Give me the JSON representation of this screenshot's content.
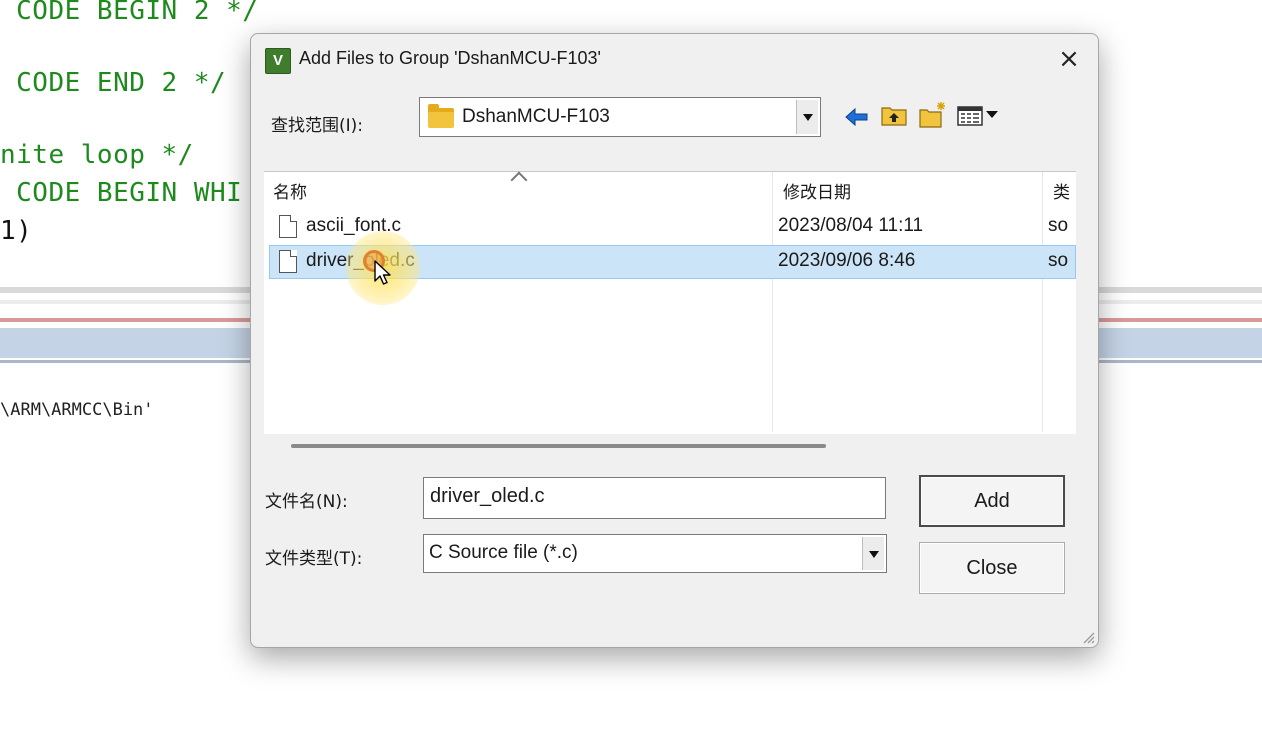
{
  "editor": {
    "lines": [
      {
        "text": " CODE BEGIN 2 */",
        "color": "#1e8a1e"
      },
      {
        "text": " CODE END 2 */",
        "color": "#1e8a1e"
      },
      {
        "text": "nite loop */",
        "color": "#1e8a1e"
      },
      {
        "text": " CODE BEGIN WHI",
        "color": "#1e8a1e"
      },
      {
        "text": "1)",
        "color": "#111111"
      }
    ],
    "build_output": "\\ARM\\ARMCC\\Bin'"
  },
  "dialog": {
    "title": "Add Files to Group 'DshanMCU-F103'",
    "app_icon": "keil-uvision-icon",
    "close_icon": "×",
    "look_in_label": "查找范围(I):",
    "look_in_value": "DshanMCU-F103",
    "toolbar": [
      "back-icon",
      "up-folder-icon",
      "new-folder-icon",
      "view-menu-icon"
    ],
    "columns": [
      "名称",
      "修改日期",
      "类"
    ],
    "files": [
      {
        "name": "ascii_font.c",
        "modified": "2023/08/04 11:11",
        "type": "so",
        "selected": false
      },
      {
        "name": "driver_oled.c",
        "modified": "2023/09/06 8:46",
        "type": "so",
        "selected": true
      }
    ],
    "filename_label": "文件名(N):",
    "filename_value": "driver_oled.c",
    "filetype_label": "文件类型(T):",
    "filetype_value": "C Source file (*.c)",
    "add_label": "Add",
    "close_label": "Close",
    "accent": "#cce4f7"
  }
}
